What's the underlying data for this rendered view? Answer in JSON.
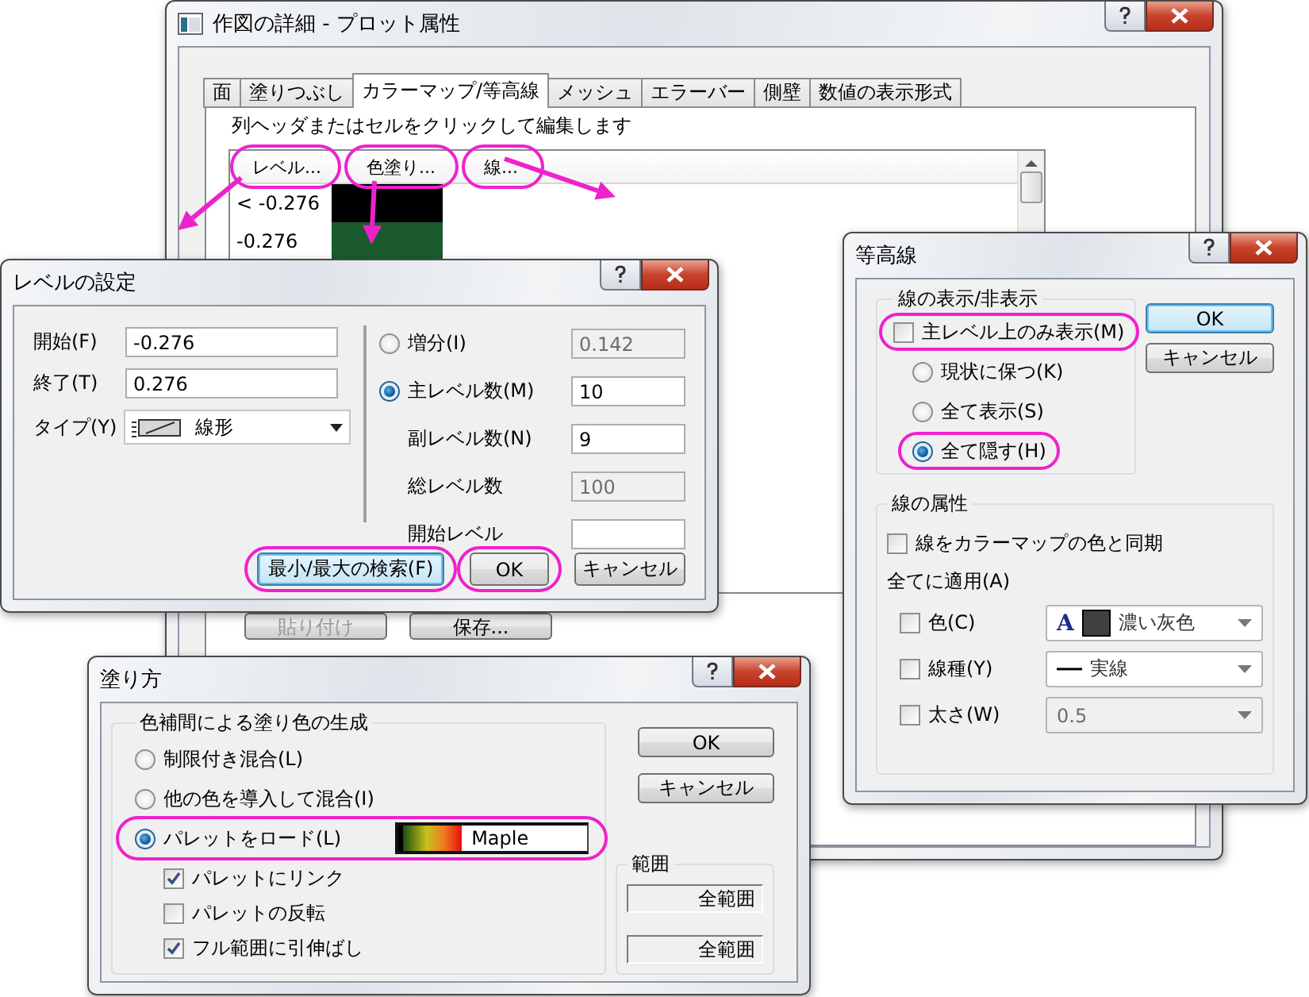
{
  "main_window": {
    "title": "作図の詳細 - プロット属性",
    "tabs": [
      {
        "label": "面",
        "selected": false
      },
      {
        "label": "塗りつぶし",
        "selected": false
      },
      {
        "label": "カラーマップ/等高線",
        "selected": true
      },
      {
        "label": "メッシュ",
        "selected": false
      },
      {
        "label": "エラーバー",
        "selected": false
      },
      {
        "label": "側壁",
        "selected": false
      },
      {
        "label": "数値の表示形式",
        "selected": false
      }
    ],
    "hint": "列ヘッダまたはセルをクリックして編集します",
    "table": {
      "columns": [
        {
          "label": "レベル...",
          "highlighted": true
        },
        {
          "label": "色塗り...",
          "highlighted": true
        },
        {
          "label": "線...",
          "highlighted": true
        }
      ],
      "rows": [
        {
          "level": "< -0.276",
          "color": "#000000"
        },
        {
          "level": "-0.276",
          "color": "#1b5a2c"
        }
      ]
    },
    "buttons": [
      {
        "label": "貼り付け",
        "disabled": true
      },
      {
        "label": "保存...",
        "disabled": false
      }
    ]
  },
  "level_dialog": {
    "title": "レベルの設定",
    "fields": [
      {
        "kind": "text",
        "label": "開始(F)",
        "value": "-0.276"
      },
      {
        "kind": "text",
        "label": "終了(T)",
        "value": "0.276"
      },
      {
        "kind": "dropdown",
        "label": "タイプ(Y)",
        "value": "線形"
      }
    ],
    "right_rows": [
      {
        "kind": "radio",
        "label": "増分(I)",
        "selected": false,
        "value": "0.142",
        "disabled": true
      },
      {
        "kind": "radio",
        "label": "主レベル数(M)",
        "selected": true,
        "value": "10",
        "disabled": false
      },
      {
        "kind": "plain",
        "label": "副レベル数(N)",
        "value": "9",
        "disabled": false
      },
      {
        "kind": "plain",
        "label": "総レベル数",
        "value": "100",
        "disabled": true
      },
      {
        "kind": "plain",
        "label": "開始レベル",
        "disabled": false
      }
    ],
    "buttons": [
      {
        "label": "最小/最大の検索(F)",
        "focused": true,
        "highlighted": true
      },
      {
        "label": "OK",
        "focused": false,
        "highlighted": true
      },
      {
        "label": "キャンセル",
        "focused": false,
        "highlighted": false
      }
    ]
  },
  "contour_dialog": {
    "title": "等高線",
    "visibility_group": {
      "title": "線の表示/非表示",
      "checkbox": {
        "label": "主レベル上のみ表示(M)",
        "checked": false,
        "highlighted": true
      },
      "radios": [
        {
          "label": "現状に保つ(K)",
          "selected": false,
          "highlighted": false
        },
        {
          "label": "全て表示(S)",
          "selected": false,
          "highlighted": false
        },
        {
          "label": "全て隠す(H)",
          "selected": true,
          "highlighted": true
        }
      ]
    },
    "buttons": [
      {
        "label": "OK",
        "focused": true
      },
      {
        "label": "キャンセル",
        "focused": false
      }
    ],
    "attributes_group": {
      "title": "線の属性",
      "sync_checkbox": {
        "label": "線をカラーマップの色と同期",
        "checked": false
      },
      "apply_all": "全てに適用(A)",
      "rows": [
        {
          "kind": "color",
          "label": "色(C)",
          "checked": false,
          "glyph": "A",
          "color": "#404040",
          "value": "濃い灰色",
          "disabled": false
        },
        {
          "kind": "linetype",
          "label": "線種(Y)",
          "checked": false,
          "value": "実線",
          "disabled": false
        },
        {
          "kind": "width",
          "label": "太さ(W)",
          "checked": false,
          "value": "0.5",
          "disabled": true
        }
      ]
    }
  },
  "fill_dialog": {
    "title": "塗り方",
    "group": {
      "title": "色補間による塗り色の生成",
      "radios": [
        {
          "label": "制限付き混合(L)",
          "selected": false,
          "highlighted": false
        },
        {
          "label": "他の色を導入して混合(I)",
          "selected": false,
          "highlighted": false
        },
        {
          "label": "パレットをロード(L)",
          "selected": true,
          "highlighted": true,
          "palette": "Maple"
        }
      ],
      "checkboxes": [
        {
          "label": "パレットにリンク",
          "checked": true
        },
        {
          "label": "パレットの反転",
          "checked": false
        },
        {
          "label": "フル範囲に引伸ばし",
          "checked": true
        }
      ]
    },
    "buttons": [
      {
        "label": "OK",
        "focused": false
      },
      {
        "label": "キャンセル",
        "focused": false
      }
    ],
    "range": {
      "title": "範囲",
      "fields": [
        "全範囲",
        "全範囲"
      ]
    }
  }
}
